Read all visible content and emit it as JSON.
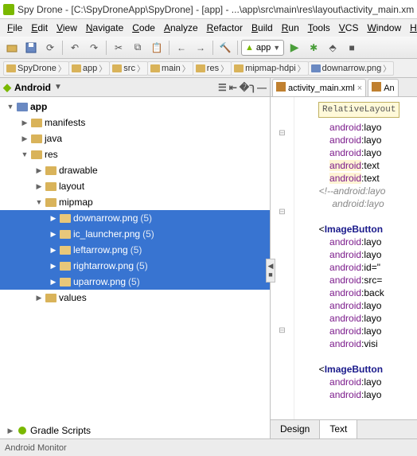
{
  "window": {
    "title": "Spy Drone - [C:\\SpyDroneApp\\SpyDrone] - [app] - ...\\app\\src\\main\\res\\layout\\activity_main.xm"
  },
  "menu": {
    "items": [
      "File",
      "Edit",
      "View",
      "Navigate",
      "Code",
      "Analyze",
      "Refactor",
      "Build",
      "Run",
      "Tools",
      "VCS",
      "Window",
      "H"
    ]
  },
  "toolbar": {
    "run_config": "app"
  },
  "breadcrumb": {
    "items": [
      "SpyDrone",
      "app",
      "src",
      "main",
      "res",
      "mipmap-hdpi",
      "downarrow.png"
    ]
  },
  "project_pane": {
    "title": "Android",
    "root": "app",
    "nodes": [
      {
        "depth": 0,
        "arrow": "▼",
        "icon": "module",
        "label": "app",
        "sel": false,
        "bold": true
      },
      {
        "depth": 1,
        "arrow": "▶",
        "icon": "dir",
        "label": "manifests",
        "sel": false
      },
      {
        "depth": 1,
        "arrow": "▶",
        "icon": "dir",
        "label": "java",
        "sel": false
      },
      {
        "depth": 1,
        "arrow": "▼",
        "icon": "dir",
        "label": "res",
        "sel": false
      },
      {
        "depth": 2,
        "arrow": "▶",
        "icon": "dir",
        "label": "drawable",
        "sel": false
      },
      {
        "depth": 2,
        "arrow": "▶",
        "icon": "dir",
        "label": "layout",
        "sel": false
      },
      {
        "depth": 2,
        "arrow": "▼",
        "icon": "dir",
        "label": "mipmap",
        "sel": false
      },
      {
        "depth": 3,
        "arrow": "▶",
        "icon": "dir",
        "label": "downarrow.png",
        "count": "(5)",
        "sel": true
      },
      {
        "depth": 3,
        "arrow": "▶",
        "icon": "dir",
        "label": "ic_launcher.png",
        "count": "(5)",
        "sel": true
      },
      {
        "depth": 3,
        "arrow": "▶",
        "icon": "dir",
        "label": "leftarrow.png",
        "count": "(5)",
        "sel": true
      },
      {
        "depth": 3,
        "arrow": "▶",
        "icon": "dir",
        "label": "rightarrow.png",
        "count": "(5)",
        "sel": true
      },
      {
        "depth": 3,
        "arrow": "▶",
        "icon": "dir",
        "label": "uparrow.png",
        "count": "(5)",
        "sel": true
      },
      {
        "depth": 2,
        "arrow": "▶",
        "icon": "dir",
        "label": "values",
        "sel": false
      }
    ],
    "bottom": {
      "arrow": "▶",
      "label": "Gradle Scripts"
    }
  },
  "editor": {
    "tabs": [
      {
        "label": "activity_main.xml",
        "close": true
      },
      {
        "label": "An",
        "close": false
      }
    ],
    "hint": "RelativeLayout",
    "lines": [
      {
        "t": "attr",
        "text": "android",
        "suffix": ":layo"
      },
      {
        "t": "attr",
        "text": "android",
        "suffix": ":layo"
      },
      {
        "t": "attr",
        "text": "android",
        "suffix": ":layo"
      },
      {
        "t": "attr",
        "text": "android",
        "suffix": ":text",
        "hl": true
      },
      {
        "t": "attr",
        "text": "android",
        "suffix": ":text",
        "hl": true
      },
      {
        "t": "comment",
        "full": "<!--android:layo"
      },
      {
        "t": "comment_i",
        "full": "android:layo"
      },
      {
        "t": "blank"
      },
      {
        "t": "tag",
        "full": "<ImageButton"
      },
      {
        "t": "attr",
        "text": "android",
        "suffix": ":layo"
      },
      {
        "t": "attr",
        "text": "android",
        "suffix": ":layo"
      },
      {
        "t": "attr",
        "text": "android",
        "suffix": ":id=\""
      },
      {
        "t": "attr",
        "text": "android",
        "suffix": ":src="
      },
      {
        "t": "attr",
        "text": "android",
        "suffix": ":back"
      },
      {
        "t": "attr",
        "text": "android",
        "suffix": ":layo"
      },
      {
        "t": "attr",
        "text": "android",
        "suffix": ":layo"
      },
      {
        "t": "attr",
        "text": "android",
        "suffix": ":layo"
      },
      {
        "t": "attr",
        "text": "android",
        "suffix": ":visi"
      },
      {
        "t": "blank"
      },
      {
        "t": "tag",
        "full": "<ImageButton"
      },
      {
        "t": "attr",
        "text": "android",
        "suffix": ":layo"
      },
      {
        "t": "attr",
        "text": "android",
        "suffix": ":layo"
      }
    ],
    "bottom_tabs": {
      "design": "Design",
      "text": "Text",
      "active": "text"
    }
  },
  "statusbar": {
    "label": "Android Monitor"
  }
}
